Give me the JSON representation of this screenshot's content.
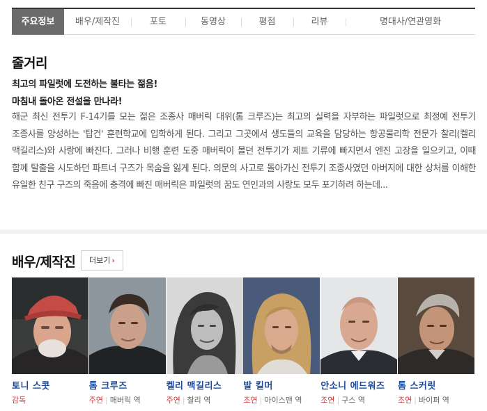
{
  "tabs": [
    {
      "label": "주요정보",
      "active": true
    },
    {
      "label": "배우/제작진"
    },
    {
      "label": "포토"
    },
    {
      "label": "동영상"
    },
    {
      "label": "평점"
    },
    {
      "label": "리뷰"
    },
    {
      "label": "명대사/연관영화"
    }
  ],
  "synopsis": {
    "heading": "줄거리",
    "tagline1": "최고의 파일럿에 도전하는 불타는 젊음!",
    "tagline2": "마침내 돌아온 전설을 만나라!",
    "body": "해군 최신 전투기 F-14기를 모는 젊은 조종사 매버릭 대위(톰 크루즈)는 최고의 실력을 자부하는 파일럿으로 최정예 전투기 조종사를 양성하는 '탑건' 훈련학교에 입학하게 된다. 그리고 그곳에서 생도들의 교육을 담당하는 항공물리학 전문가 찰리(켈리 맥길리스)와 사랑에 빠진다. 그러나 비행 훈련 도중 매버릭이 몰던 전투기가 제트 기류에 빠지면서 엔진 고장을 일으키고, 이때 함께 탈출을 시도하던 파트너 구즈가 목숨을 잃게 된다. 의문의 사고로 돌아가신 전투기 조종사였던 아버지에 대한 상처를 이해한 유일한 친구 구즈의 죽음에 충격에 빠진 매버릭은 파일럿의 꿈도 연인과의 사랑도 모두 포기하려 하는데..."
  },
  "cast_section": {
    "heading": "배우/제작진",
    "more_label": "더보기",
    "members": [
      {
        "name": "토니 스콧",
        "type": "감독",
        "role": ""
      },
      {
        "name": "톰 크루즈",
        "type": "주연",
        "role": "매버릭 역"
      },
      {
        "name": "켈리 맥길리스",
        "type": "주연",
        "role": "찰리 역"
      },
      {
        "name": "발 킬머",
        "type": "조연",
        "role": "아이스맨 역"
      },
      {
        "name": "안소니 에드워즈",
        "type": "조연",
        "role": "구스 역"
      },
      {
        "name": "톰 스커릿",
        "type": "조연",
        "role": "바이퍼 역"
      }
    ]
  },
  "colors": {
    "active_tab_bg": "#6b6b6b",
    "cast_name": "#1a4a9c",
    "role_type": "#d2373b"
  }
}
